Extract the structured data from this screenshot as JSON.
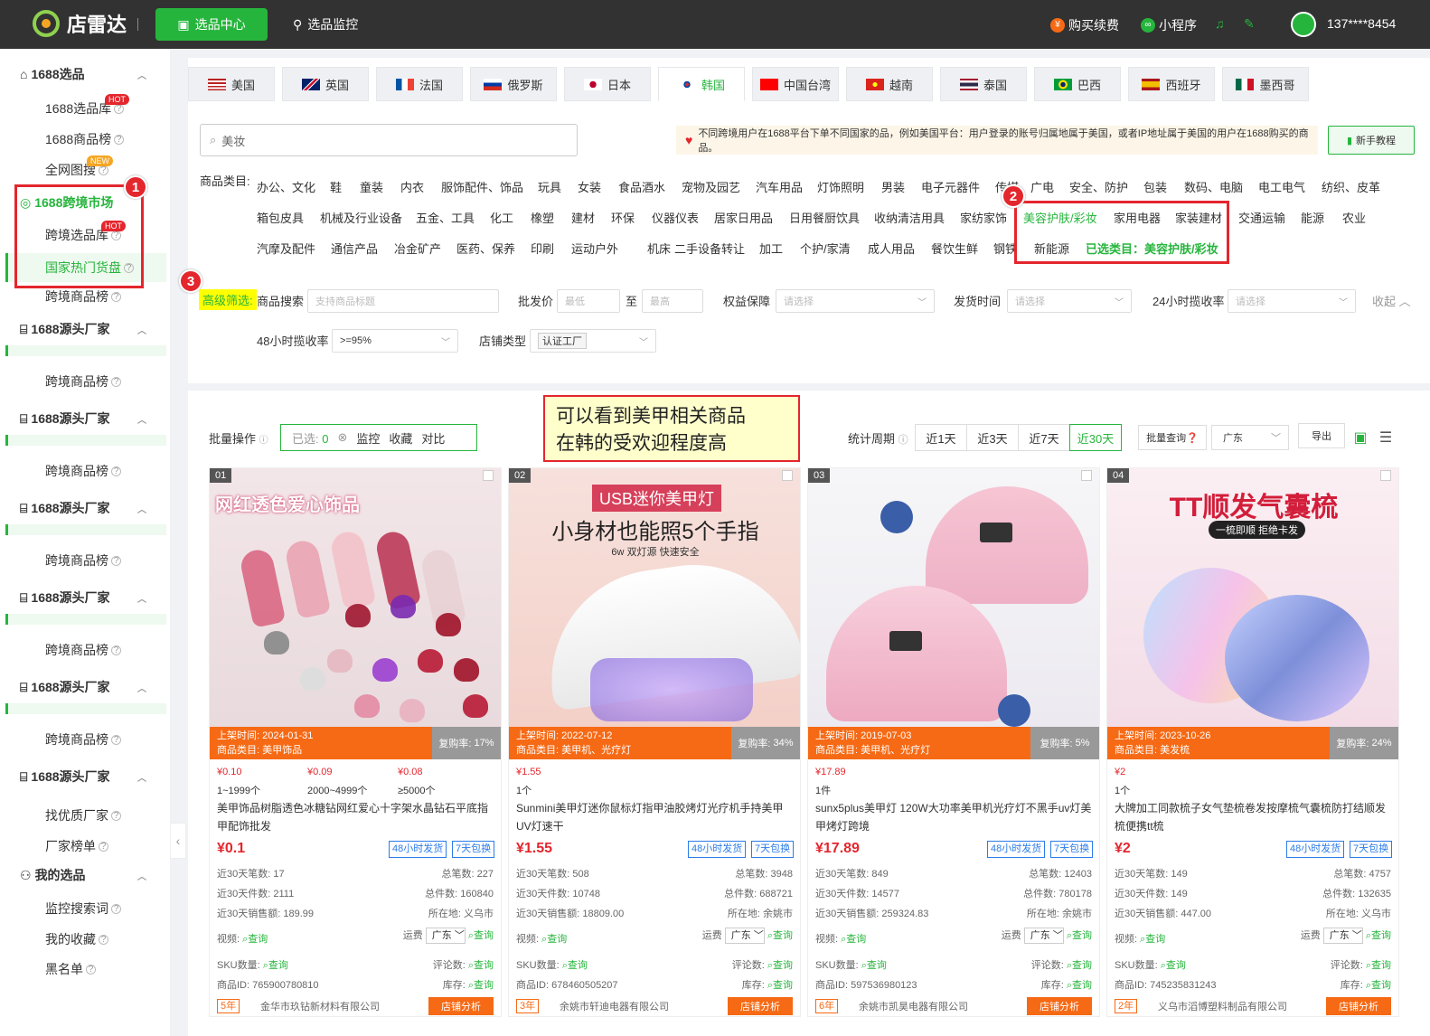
{
  "header": {
    "app_name": "店雷达",
    "nav_active": "选品中心",
    "nav_monitor": "选品监控",
    "buy": "购买续费",
    "miniprogram": "小程序",
    "user": "137****8454"
  },
  "sidebar": {
    "g1_title": "1688选品",
    "g1_items": [
      "1688选品库",
      "1688商品榜",
      "全网图搜"
    ],
    "g2_title": "1688跨境市场",
    "g2_items": [
      "跨境选品库",
      "国家热门货盘",
      "跨境商品榜"
    ],
    "factory_title": "1688源头厂家",
    "cross_rank": "跨境商品榜",
    "g_last_items": [
      "找优质厂家",
      "厂家榜单"
    ],
    "mine_title": "我的选品",
    "mine_items": [
      "监控搜索词",
      "我的收藏",
      "黑名单"
    ],
    "hot": "HOT",
    "new": "NEW"
  },
  "badges": [
    "1",
    "2",
    "3"
  ],
  "tabs": [
    "美国",
    "英国",
    "法国",
    "俄罗斯",
    "日本",
    "韩国",
    "中国台湾",
    "越南",
    "泰国",
    "巴西",
    "西班牙",
    "墨西哥"
  ],
  "search": {
    "value": "美妆"
  },
  "notice": "不同跨境用户在1688平台下单不同国家的品，例如美国平台：用户登录的账号归属地属于美国，或者IP地址属于美国的用户在1688购买的商品。",
  "tutorial": "新手教程",
  "categories": {
    "label": "商品类目:",
    "row1": [
      "办公、文化",
      "鞋",
      "童装",
      "内衣",
      "服饰配件、饰品",
      "玩具",
      "女装",
      "食品酒水",
      "宠物及园艺",
      "汽车用品",
      "灯饰照明",
      "男装",
      "电子元器件",
      "传媒、广电",
      "安全、防护",
      "包装",
      "数码、电脑",
      "电工电气",
      "纺织、皮革"
    ],
    "row2": [
      "箱包皮具",
      "机械及行业设备",
      "五金、工具",
      "化工",
      "橡塑",
      "建材",
      "环保",
      "仪器仪表",
      "居家日用品",
      "日用餐厨饮具",
      "收纳清洁用具",
      "家纺家饰",
      "美容护肤/彩妆",
      "家用电器",
      "家装建材",
      "交通运输",
      "能源",
      "农业"
    ],
    "row3": [
      "汽摩及配件",
      "通信产品",
      "冶金矿产",
      "医药、保养",
      "印刷",
      "运动户外",
      "机床",
      "二手设备转让",
      "加工",
      "个护/家清",
      "成人用品",
      "餐饮生鲜",
      "钢铁",
      "新能源"
    ],
    "selected": "已选类目：美容护肤/彩妆"
  },
  "filters": {
    "advanced": "高级筛选:",
    "product_search": "商品搜索",
    "product_search_ph": "支持商品标题",
    "wholesale": "批发价",
    "min": "最低",
    "to": "至",
    "max": "最高",
    "rights": "权益保障",
    "pick": "请选择",
    "ship_time": "发货时间",
    "pickup24": "24小时揽收率",
    "collapse": "收起",
    "pickup48": "48小时揽收率",
    "pickup48_val": ">=95%",
    "shop_type": "店铺类型",
    "shop_type_val": "认证工厂"
  },
  "toolbar": {
    "batch": "批量操作",
    "selected": "已选:",
    "selected_count": "0",
    "monitor": "监控",
    "fav": "收藏",
    "compare": "对比",
    "period_label": "统计周期",
    "periods": [
      "近1天",
      "近3天",
      "近7天",
      "近30天"
    ],
    "batch_query": "批量查询",
    "region": "广东",
    "export": "导出"
  },
  "callout": [
    "可以看到美甲相关商品",
    "在韩的受欢迎程度高"
  ],
  "labels": {
    "listed": "上架时间:",
    "cat": "商品类目:",
    "rebuy": "复购率:",
    "n30_orders": "近30天笔数:",
    "total_orders": "总笔数:",
    "n30_pieces": "近30天件数:",
    "total_pieces": "总件数:",
    "n30_sales": "近30天销售额:",
    "location": "所在地:",
    "video": "视频:",
    "query": "查询",
    "freight": "运费",
    "sku": "SKU数量:",
    "reviews": "评论数:",
    "pid": "商品ID:",
    "stock": "库存:",
    "shop_analysis": "店铺分析",
    "tag48": "48小时发货",
    "tag7": "7天包换"
  },
  "products": [
    {
      "no": "01",
      "img_text": "网红透色爱心饰品",
      "listed": "2024-01-31",
      "cat": "美甲饰品",
      "rebuy": "17%",
      "tiers": [
        [
          "¥0.10",
          "1~1999个"
        ],
        [
          "¥0.09",
          "2000~4999个"
        ],
        [
          "¥0.08",
          "≥5000个"
        ]
      ],
      "title": "美甲饰品树脂透色冰糖钻网红爱心十字架水晶钻石平底指甲配饰批发",
      "price": "¥0.1",
      "n30_orders": "17",
      "total_orders": "227",
      "n30_pieces": "2111",
      "total_pieces": "160840",
      "n30_sales": "189.99",
      "location": "义乌市",
      "region": "广东",
      "pid": "765900780810",
      "years": "5年",
      "shop": "金华市玖钻新材料有限公司"
    },
    {
      "no": "02",
      "img_text": "USB迷你美甲灯",
      "img_sub": "小身材也能照5个手指",
      "img_sub2": "6w 双灯源 快速安全",
      "listed": "2022-07-12",
      "cat": "美甲机、光疗灯",
      "rebuy": "34%",
      "tiers": [
        [
          "¥1.55",
          "1个"
        ]
      ],
      "title": "Sunmini美甲灯迷你鼠标灯指甲油胶烤灯光疗机手持美甲UV灯速干",
      "price": "¥1.55",
      "n30_orders": "508",
      "total_orders": "3948",
      "n30_pieces": "10748",
      "total_pieces": "688721",
      "n30_sales": "18809.00",
      "location": "余姚市",
      "region": "广东",
      "pid": "678460505207",
      "years": "3年",
      "shop": "余姚市轩迪电器有限公司"
    },
    {
      "no": "03",
      "img_text": "",
      "listed": "2019-07-03",
      "cat": "美甲机、光疗灯",
      "rebuy": "5%",
      "tiers": [
        [
          "¥17.89",
          "1件"
        ]
      ],
      "title": "sunx5plus美甲灯 120W大功率美甲机光疗灯不黑手uv灯美甲烤灯跨境",
      "price": "¥17.89",
      "n30_orders": "849",
      "total_orders": "12403",
      "n30_pieces": "14577",
      "total_pieces": "780178",
      "n30_sales": "259324.83",
      "location": "余姚市",
      "region": "广东",
      "pid": "597536980123",
      "years": "6年",
      "shop": "余姚市凯昊电器有限公司"
    },
    {
      "no": "04",
      "img_text": "TT顺发气囊梳",
      "img_sub": "一梳即顺 拒绝卡发",
      "listed": "2023-10-26",
      "cat": "美发梳",
      "rebuy": "24%",
      "tiers": [
        [
          "¥2",
          "1个"
        ]
      ],
      "title": "大牌加工同款梳子女气垫梳卷发按摩梳气囊梳防打结顺发梳便携tt梳",
      "price": "¥2",
      "n30_orders": "149",
      "total_orders": "4757",
      "n30_pieces": "149",
      "total_pieces": "132635",
      "n30_sales": "447.00",
      "location": "义乌市",
      "region": "广东",
      "pid": "745235831243",
      "years": "2年",
      "shop": "义乌市滔博塑料制品有限公司"
    }
  ]
}
